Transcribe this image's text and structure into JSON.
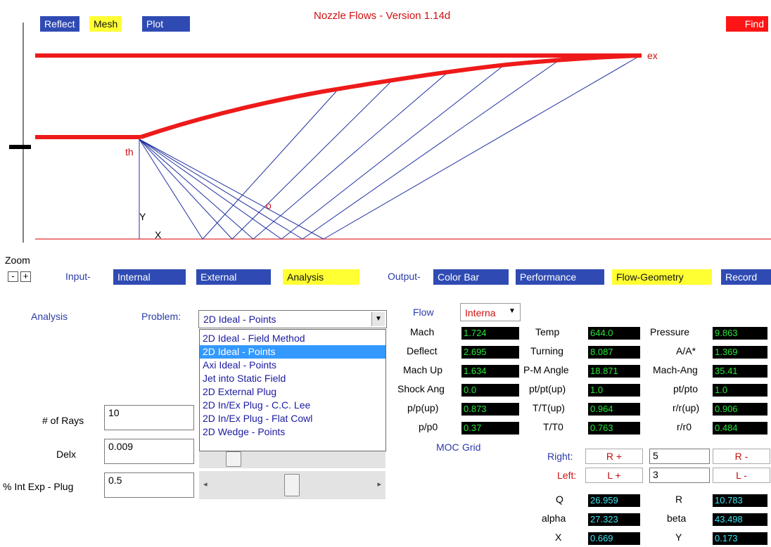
{
  "top_buttons": {
    "reflect": "Reflect",
    "mesh": "Mesh",
    "plot": "Plot",
    "find": "Find"
  },
  "title": "Nozzle Flows - Version 1.14d",
  "diagram_labels": {
    "throat": "th",
    "exit": "ex",
    "y_axis": "Y",
    "x_axis": "X",
    "point": "o"
  },
  "zoom": {
    "label": "Zoom",
    "minus": "-",
    "plus": "+"
  },
  "input_nav": {
    "label": "Input-",
    "internal": "Internal",
    "external": "External",
    "analysis": "Analysis"
  },
  "output_nav": {
    "label": "Output-",
    "color_bar": "Color Bar",
    "performance": "Performance",
    "flow_geometry": "Flow-Geometry",
    "record": "Record"
  },
  "analysis_panel": {
    "heading": "Analysis",
    "problem_label": "Problem:",
    "problem_selected": "2D Ideal - Points",
    "problem_options": [
      "2D Ideal - Field Method",
      "2D Ideal - Points",
      "Axi Ideal - Points",
      "Jet into Static Field",
      "2D External Plug",
      "2D In/Ex Plug - C.C. Lee",
      "2D In/Ex Plug - Flat Cowl",
      "2D Wedge - Points"
    ],
    "rays_label": "# of Rays",
    "rays_value": "10",
    "delx_label": "Delx",
    "delx_value": "0.009",
    "intexp_label": "% Int Exp - Plug",
    "intexp_value": "0.5"
  },
  "flow_panel": {
    "flow_label": "Flow",
    "flow_select": "Interna",
    "rows": [
      [
        {
          "label": "Mach",
          "value": "1.724"
        },
        {
          "label": "Temp",
          "value": "644.0"
        },
        {
          "label": "Pressure",
          "value": "9.863"
        }
      ],
      [
        {
          "label": "Deflect",
          "value": "2.695"
        },
        {
          "label": "Turning",
          "value": "8.087"
        },
        {
          "label": "A/A*",
          "value": "1.369"
        }
      ],
      [
        {
          "label": "Mach Up",
          "value": "1.634"
        },
        {
          "label": "P-M Angle",
          "value": "18.871"
        },
        {
          "label": "Mach-Ang",
          "value": "35.41"
        }
      ],
      [
        {
          "label": "Shock Ang",
          "value": "0.0"
        },
        {
          "label": "pt/pt(up)",
          "value": "1.0"
        },
        {
          "label": "pt/pto",
          "value": "1.0"
        }
      ],
      [
        {
          "label": "p/p(up)",
          "value": "0.873"
        },
        {
          "label": "T/T(up)",
          "value": "0.964"
        },
        {
          "label": "r/r(up)",
          "value": "0.906"
        }
      ],
      [
        {
          "label": "p/p0",
          "value": "0.37"
        },
        {
          "label": "T/T0",
          "value": "0.763"
        },
        {
          "label": "r/r0",
          "value": "0.484"
        }
      ]
    ],
    "moc_label": "MOC",
    "grid_label": "Grid",
    "right_label": "Right:",
    "right_plus": "R +",
    "right_value": "5",
    "right_minus": "R -",
    "left_label": "Left:",
    "left_plus": "L +",
    "left_value": "3",
    "left_minus": "L -",
    "q_label": "Q",
    "q_value": "26.959",
    "r_label": "R",
    "r_value": "10.783",
    "alpha_label": "alpha",
    "alpha_value": "27.323",
    "beta_label": "beta",
    "beta_value": "43.498",
    "x_label": "X",
    "x_value": "0.669",
    "y_label": "Y",
    "y_value": "0.173"
  },
  "colors": {
    "accent_blue": "#2f4bb3",
    "accent_yellow": "#ffff33",
    "accent_red": "#ff1515",
    "value_green": "#27e53a"
  }
}
